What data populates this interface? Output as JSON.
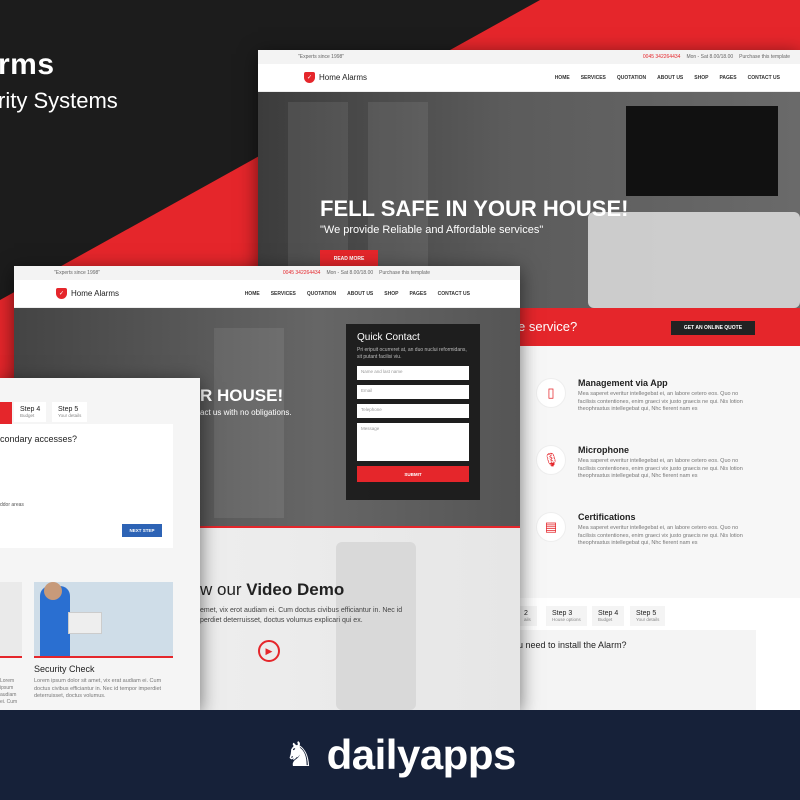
{
  "bg_brand": {
    "title": "rms",
    "tagline": "rity Systems"
  },
  "topbar": {
    "tag": "\"Experts since 1998\"",
    "phone": "0045 342264434",
    "hours": "Mon - Sat 8.00/18.00",
    "purchase": "Purchase this template"
  },
  "logo": {
    "text": "Home Alarms"
  },
  "menu": [
    "HOME",
    "SERVICES",
    "QUOTATION",
    "ABOUT US",
    "SHOP",
    "PAGES",
    "CONTACT US"
  ],
  "win1": {
    "headline": "FELL SAFE IN YOUR HOUSE!",
    "sub": "\"We provide Reliable and Affordable services\"",
    "read_more": "READ MORE"
  },
  "win2": {
    "headline": "R HOUSE!",
    "sub": "act us with no obligations.",
    "quick_contact": {
      "title": "Quick Contact",
      "desc": "Pri eripuit ocurreret at, an duo nuclui reformidans, sit putant facilisi viu.",
      "name": "Name and last name",
      "email": "Email",
      "phone": "Telephone",
      "message": "Message",
      "submit": "SUBMIT"
    },
    "video_title_prefix": "w our ",
    "video_title_bold": "Video Demo",
    "video_text": "emet, vix erot audiam ei. Cum doctus civibus efficiantur in. Nec id perdiet deterruisset, doctus volumus explicari qui ex."
  },
  "services": {
    "bar_text": "e service?",
    "quote_button": "GET AN ONLINE QUOTE",
    "items": [
      {
        "title": "Management via App",
        "text": "Mea saperet everitur intellegebat ei, an labore cetero eos. Quo no facilisis contentiones, enim graeci vix justo graecis ne qui. Nis lotion theophrastus intellegebat qui, Nhc fierent nam es"
      },
      {
        "title": "Microphone",
        "text": "Mea saperet everitur intellegebat ei, an labore cetero eos. Quo no facilisis contentiones, enim graeci vix justo graecis ne qui. Nis lotion theophrastus intellegebat qui, Nhc fierent nam es"
      },
      {
        "title": "Certifications",
        "text": "Mea saperet everitur intellegebat ei, an labore cetero eos. Quo no facilisis contentiones, enim graeci vix justo graecis ne qui. Nis lotion theophrastus intellegebat qui, Nhc fierent nam es"
      }
    ],
    "steps": [
      {
        "label": "2",
        "sub": "ails"
      },
      {
        "label": "Step 3",
        "sub": "House options"
      },
      {
        "label": "Step 4",
        "sub": "Budget"
      },
      {
        "label": "Step 5",
        "sub": "Your details"
      }
    ],
    "question": "u need to install the Alarm?"
  },
  "win3": {
    "steps": [
      {
        "label": "Step 4",
        "sub": "Budget"
      },
      {
        "label": "Step 5",
        "sub": "Your details"
      }
    ],
    "question": "condary accesses?",
    "option": "ddor areas",
    "next": "NEXT STEP",
    "card_title": "Security Check",
    "card_text_left": "Lorem ipsum audiam ei. Cum doctus civibus efficiantur in.",
    "card_text": "Lorem ipsum dolor sit amet, vix erat audiam ei. Cum doctus civibus efficiantur in. Nec id tempor imperdiet deterruisset, doctus volumus."
  },
  "footer": {
    "brand": "dailyapps"
  },
  "colors": {
    "accent": "#e5262b",
    "footer": "#162139"
  }
}
